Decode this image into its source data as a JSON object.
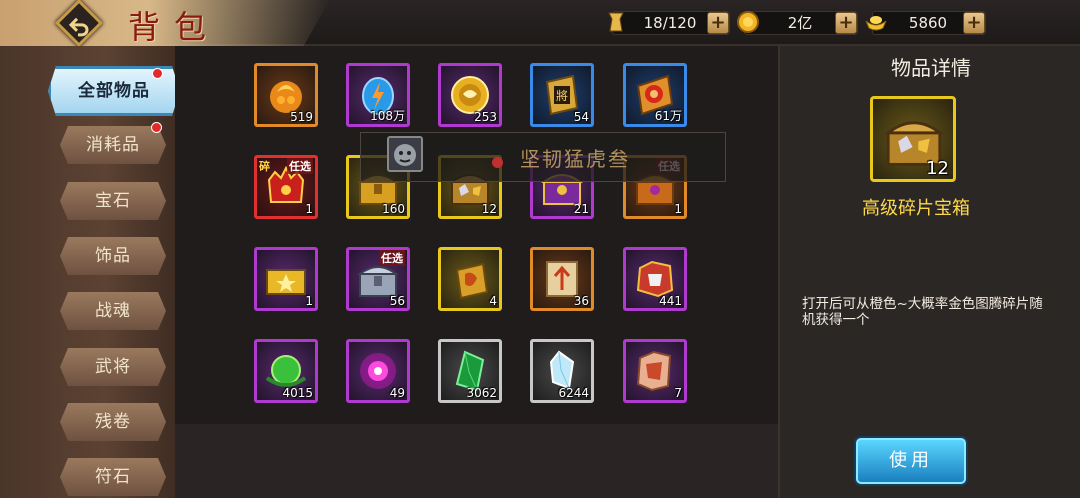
{
  "header": {
    "title": "背包"
  },
  "resources": [
    {
      "name": "bag-capacity",
      "value": "18/120"
    },
    {
      "name": "gold-coins",
      "value": "2亿"
    },
    {
      "name": "ingots",
      "value": "5860"
    }
  ],
  "sidebar": {
    "items": [
      {
        "label": "全部物品",
        "active": true,
        "badge": true
      },
      {
        "label": "消耗品",
        "badge": true
      },
      {
        "label": "宝石"
      },
      {
        "label": "饰品"
      },
      {
        "label": "战魂"
      },
      {
        "label": "武将"
      },
      {
        "label": "残卷"
      },
      {
        "label": "符石"
      }
    ]
  },
  "grid": {
    "items": [
      {
        "count": "519",
        "rarity": "orange"
      },
      {
        "count": "108万",
        "rarity": "purple"
      },
      {
        "count": "253",
        "rarity": "purple"
      },
      {
        "count": "54",
        "rarity": "blue"
      },
      {
        "count": "61万",
        "rarity": "blue"
      },
      {
        "count": "1",
        "rarity": "red",
        "tag": "任选",
        "tag_left": "碎"
      },
      {
        "count": "160",
        "rarity": "gold"
      },
      {
        "count": "12",
        "rarity": "gold",
        "selected": true
      },
      {
        "count": "21",
        "rarity": "purple"
      },
      {
        "count": "1",
        "rarity": "orange",
        "tag": "任选"
      },
      {
        "count": "1",
        "rarity": "purple"
      },
      {
        "count": "56",
        "rarity": "purple",
        "tag": "任选"
      },
      {
        "count": "4",
        "rarity": "gold"
      },
      {
        "count": "36",
        "rarity": "orange"
      },
      {
        "count": "441",
        "rarity": "purple"
      },
      {
        "count": "4015",
        "rarity": "purple"
      },
      {
        "count": "49",
        "rarity": "purple"
      },
      {
        "count": "3062",
        "rarity": "white"
      },
      {
        "count": "6244",
        "rarity": "white"
      },
      {
        "count": "7",
        "rarity": "purple"
      }
    ]
  },
  "tooltip": {
    "text": "坚韧猛虎叁"
  },
  "detail": {
    "title": "物品详情",
    "item_count": "12",
    "item_name": "高级碎片宝箱",
    "description": "打开后可从橙色~大概率金色图腾碎片随机获得一个",
    "use_label": "使用"
  },
  "colors": {
    "accent": "#e8c81a",
    "use_button": "#2aa7e0",
    "badge": "#e22a2a"
  }
}
